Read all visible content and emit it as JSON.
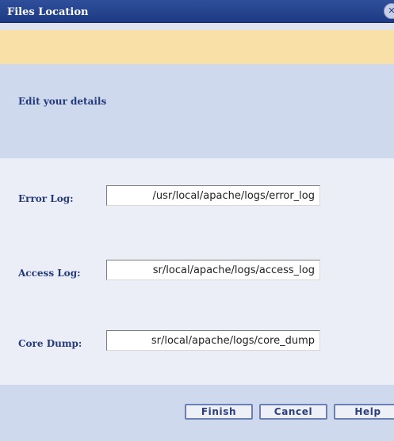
{
  "window": {
    "title": "Files Location",
    "close_glyph": "✕"
  },
  "header": {
    "text": "Edit your details"
  },
  "fields": [
    {
      "label": "Error Log:",
      "value": "/usr/local/apache/logs/error_log"
    },
    {
      "label": "Access Log:",
      "value": "sr/local/apache/logs/access_log"
    },
    {
      "label": "Core Dump:",
      "value": "sr/local/apache/logs/core_dump"
    }
  ],
  "buttons": {
    "finish": "Finish",
    "cancel": "Cancel",
    "help": "Help"
  },
  "colors": {
    "titlebar": "#1d3a84",
    "notice": "#f8e0a6",
    "band": "#cfd9ee",
    "form": "#eceef7",
    "label_text": "#243a7a"
  }
}
